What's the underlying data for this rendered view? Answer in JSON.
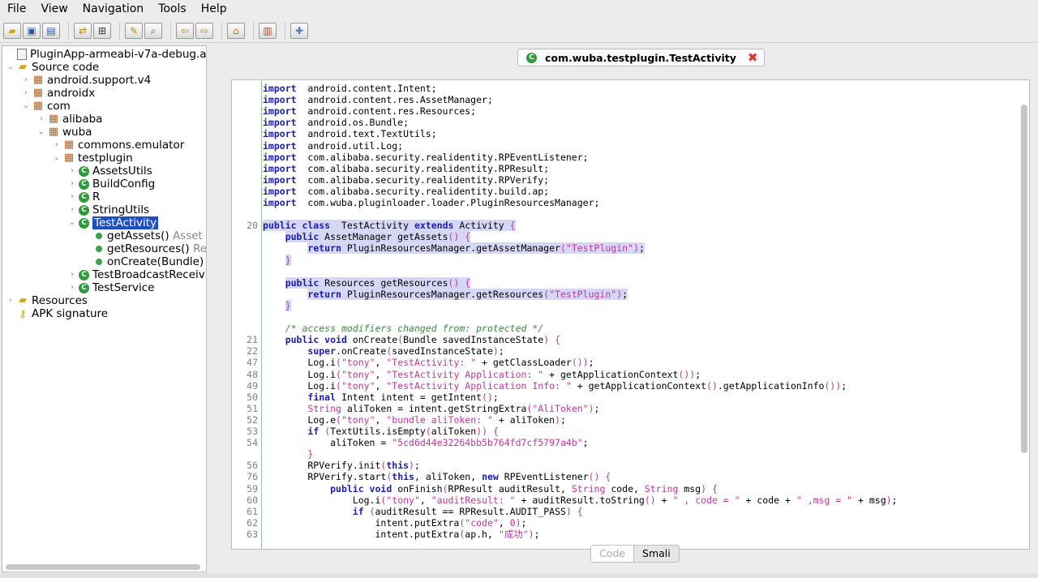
{
  "menu": [
    "File",
    "View",
    "Navigation",
    "Tools",
    "Help"
  ],
  "toolbar": {
    "groups": [
      [
        "folder-open-icon",
        "save-icon",
        "save-all-icon"
      ],
      [
        "sync-icon",
        "grid-icon"
      ],
      [
        "wand-icon",
        "search-icon"
      ],
      [
        "back-arrow-icon",
        "forward-arrow-icon"
      ],
      [
        "bag-icon"
      ],
      [
        "log-icon"
      ],
      [
        "wrench-icon"
      ]
    ]
  },
  "tree": {
    "items": [
      {
        "label": "PluginApp-armeabi-v7a-debug.apk",
        "icon": "apk-icon",
        "depth": 0,
        "chev": ""
      },
      {
        "label": "Source code",
        "icon": "folder-icon",
        "depth": 0,
        "chev": "open"
      },
      {
        "label": "android.support.v4",
        "icon": "package-icon",
        "depth": 1,
        "chev": "closed"
      },
      {
        "label": "androidx",
        "icon": "package-icon",
        "depth": 1,
        "chev": "closed"
      },
      {
        "label": "com",
        "icon": "package-icon",
        "depth": 1,
        "chev": "open"
      },
      {
        "label": "alibaba",
        "icon": "package-icon",
        "depth": 2,
        "chev": "closed"
      },
      {
        "label": "wuba",
        "icon": "package-icon",
        "depth": 2,
        "chev": "open"
      },
      {
        "label": "commons.emulator",
        "icon": "package-icon",
        "depth": 3,
        "chev": "closed"
      },
      {
        "label": "testplugin",
        "icon": "package-icon",
        "depth": 3,
        "chev": "open"
      },
      {
        "label": "AssetsUtils",
        "icon": "class-icon",
        "depth": 4,
        "chev": "closed"
      },
      {
        "label": "BuildConfig",
        "icon": "class-icon",
        "depth": 4,
        "chev": "closed"
      },
      {
        "label": "R",
        "icon": "class-icon",
        "depth": 4,
        "chev": "closed"
      },
      {
        "label": "StringUtils",
        "icon": "class-icon",
        "depth": 4,
        "chev": "closed"
      },
      {
        "label": "TestActivity",
        "icon": "class-icon",
        "depth": 4,
        "chev": "open",
        "selected": true
      },
      {
        "label": "getAssets()",
        "ret": "Asset",
        "icon": "method-icon",
        "depth": 5,
        "chev": ""
      },
      {
        "label": "getResources()",
        "ret": "Re",
        "icon": "method-icon",
        "depth": 5,
        "chev": ""
      },
      {
        "label": "onCreate(Bundle)",
        "icon": "method-icon",
        "depth": 5,
        "chev": ""
      },
      {
        "label": "TestBroadcastReceiv",
        "icon": "class-icon",
        "depth": 4,
        "chev": "closed"
      },
      {
        "label": "TestService",
        "icon": "class-icon",
        "depth": 4,
        "chev": "closed"
      },
      {
        "label": "Resources",
        "icon": "folder-icon",
        "depth": 0,
        "chev": "closed"
      },
      {
        "label": "APK signature",
        "icon": "key-icon",
        "depth": 0,
        "chev": ""
      }
    ]
  },
  "editor": {
    "tab_title": "com.wuba.testplugin.TestActivity",
    "bottom_tabs": [
      "Code",
      "Smali"
    ],
    "lines": [
      {
        "n": "",
        "t": [
          [
            "kw",
            "import"
          ],
          [
            "",
            "  android.content.Intent;"
          ]
        ]
      },
      {
        "n": "",
        "t": [
          [
            "kw",
            "import"
          ],
          [
            "",
            "  android.content.res.AssetManager;"
          ]
        ]
      },
      {
        "n": "",
        "t": [
          [
            "kw",
            "import"
          ],
          [
            "",
            "  android.content.res.Resources;"
          ]
        ]
      },
      {
        "n": "",
        "t": [
          [
            "kw",
            "import"
          ],
          [
            "",
            "  android.os.Bundle;"
          ]
        ]
      },
      {
        "n": "",
        "t": [
          [
            "kw",
            "import"
          ],
          [
            "",
            "  android.text.TextUtils;"
          ]
        ]
      },
      {
        "n": "",
        "t": [
          [
            "kw",
            "import"
          ],
          [
            "",
            "  android.util.Log;"
          ]
        ]
      },
      {
        "n": "",
        "t": [
          [
            "kw",
            "import"
          ],
          [
            "",
            "  com.alibaba.security.realidentity.RPEventListener;"
          ]
        ]
      },
      {
        "n": "",
        "t": [
          [
            "kw",
            "import"
          ],
          [
            "",
            "  com.alibaba.security.realidentity.RPResult;"
          ]
        ]
      },
      {
        "n": "",
        "t": [
          [
            "kw",
            "import"
          ],
          [
            "",
            "  com.alibaba.security.realidentity.RPVerify;"
          ]
        ]
      },
      {
        "n": "",
        "t": [
          [
            "kw",
            "import"
          ],
          [
            "",
            "  com.alibaba.security.realidentity.build.ap;"
          ]
        ]
      },
      {
        "n": "",
        "t": [
          [
            "kw",
            "import"
          ],
          [
            "",
            "  com.wuba.pluginloader.loader.PluginResourcesManager;"
          ]
        ]
      },
      {
        "n": "",
        "t": []
      },
      {
        "n": "20",
        "hl": true,
        "t": [
          [
            "kw",
            "public class"
          ],
          [
            "",
            "  TestActivity "
          ],
          [
            "kw",
            "extends"
          ],
          [
            "",
            " Activity "
          ],
          [
            "br",
            "{"
          ]
        ]
      },
      {
        "n": "",
        "hl": true,
        "t": [
          [
            "",
            "    "
          ],
          [
            "kw",
            "public"
          ],
          [
            "",
            " AssetManager getAssets"
          ],
          [
            "br",
            "()"
          ],
          [
            "",
            " "
          ],
          [
            "br",
            "{"
          ]
        ]
      },
      {
        "n": "",
        "hl": true,
        "t": [
          [
            "",
            "        "
          ],
          [
            "kw",
            "return"
          ],
          [
            "",
            " PluginResourcesManager.getAssetManager"
          ],
          [
            "br",
            "("
          ],
          [
            "str",
            "\"TestPlugin\""
          ],
          [
            "br",
            ")"
          ],
          [
            "",
            ";"
          ]
        ]
      },
      {
        "n": "",
        "hl": true,
        "t": [
          [
            "",
            "    "
          ],
          [
            "br",
            "}"
          ]
        ]
      },
      {
        "n": "",
        "t": []
      },
      {
        "n": "",
        "hl": true,
        "t": [
          [
            "",
            "    "
          ],
          [
            "kw",
            "public"
          ],
          [
            "",
            " Resources getResources"
          ],
          [
            "br",
            "()"
          ],
          [
            "",
            " "
          ],
          [
            "br",
            "{"
          ]
        ]
      },
      {
        "n": "",
        "hl": true,
        "t": [
          [
            "",
            "        "
          ],
          [
            "kw",
            "return"
          ],
          [
            "",
            " PluginResourcesManager.getResources"
          ],
          [
            "br",
            "("
          ],
          [
            "str",
            "\"TestPlugin\""
          ],
          [
            "br",
            ")"
          ],
          [
            "",
            ";"
          ]
        ]
      },
      {
        "n": "",
        "hl": true,
        "t": [
          [
            "",
            "    "
          ],
          [
            "br",
            "}"
          ]
        ]
      },
      {
        "n": "",
        "t": []
      },
      {
        "n": "",
        "t": [
          [
            "",
            "    "
          ],
          [
            "cm",
            "/* access modifiers changed from: protected */"
          ]
        ]
      },
      {
        "n": "21",
        "t": [
          [
            "",
            "    "
          ],
          [
            "kw",
            "public void"
          ],
          [
            "",
            " onCreate"
          ],
          [
            "br",
            "("
          ],
          [
            "",
            "Bundle savedInstanceState"
          ],
          [
            "br",
            ")"
          ],
          [
            "",
            " "
          ],
          [
            "br",
            "{"
          ]
        ]
      },
      {
        "n": "22",
        "t": [
          [
            "",
            "        "
          ],
          [
            "kw",
            "super"
          ],
          [
            "",
            ".onCreate"
          ],
          [
            "br",
            "("
          ],
          [
            "",
            "savedInstanceState"
          ],
          [
            "br",
            ")"
          ],
          [
            "",
            ";"
          ]
        ]
      },
      {
        "n": "47",
        "t": [
          [
            "",
            "        Log.i"
          ],
          [
            "br",
            "("
          ],
          [
            "str",
            "\"tony\""
          ],
          [
            "",
            ", "
          ],
          [
            "str",
            "\"TestActivity: \""
          ],
          [
            "",
            " + getClassLoader"
          ],
          [
            "br",
            "())"
          ],
          [
            "",
            ";"
          ]
        ]
      },
      {
        "n": "48",
        "t": [
          [
            "",
            "        Log.i"
          ],
          [
            "br",
            "("
          ],
          [
            "str",
            "\"tony\""
          ],
          [
            "",
            ", "
          ],
          [
            "str",
            "\"TestActivity Application: \""
          ],
          [
            "",
            " + getApplicationContext"
          ],
          [
            "br",
            "())"
          ],
          [
            "",
            ";"
          ]
        ]
      },
      {
        "n": "49",
        "t": [
          [
            "",
            "        Log.i"
          ],
          [
            "br",
            "("
          ],
          [
            "str",
            "\"tony\""
          ],
          [
            "",
            ", "
          ],
          [
            "str",
            "\"TestActivity Application Info: \""
          ],
          [
            "",
            " + getApplicationContext"
          ],
          [
            "br",
            "()"
          ],
          [
            "",
            ".getApplicationInfo"
          ],
          [
            "br",
            "())"
          ],
          [
            "",
            ";"
          ]
        ]
      },
      {
        "n": "50",
        "t": [
          [
            "",
            "        "
          ],
          [
            "kw",
            "final"
          ],
          [
            "",
            " Intent intent = getIntent"
          ],
          [
            "br",
            "()"
          ],
          [
            "",
            ";"
          ]
        ]
      },
      {
        "n": "51",
        "t": [
          [
            "",
            "        "
          ],
          [
            "str",
            "String"
          ],
          [
            "",
            " aliToken = intent.getStringExtra"
          ],
          [
            "br",
            "("
          ],
          [
            "str",
            "\"AliToken\""
          ],
          [
            "br",
            ")"
          ],
          [
            "",
            ";"
          ]
        ]
      },
      {
        "n": "52",
        "t": [
          [
            "",
            "        Log.e"
          ],
          [
            "br",
            "("
          ],
          [
            "str",
            "\"tony\""
          ],
          [
            "",
            ", "
          ],
          [
            "str",
            "\"bundle aliToken: \""
          ],
          [
            "",
            " + aliToken"
          ],
          [
            "br",
            ")"
          ],
          [
            "",
            ";"
          ]
        ]
      },
      {
        "n": "53",
        "t": [
          [
            "",
            "        "
          ],
          [
            "kw",
            "if"
          ],
          [
            "",
            " "
          ],
          [
            "br",
            "("
          ],
          [
            "",
            "TextUtils.isEmpty"
          ],
          [
            "br",
            "("
          ],
          [
            "",
            "aliToken"
          ],
          [
            "br",
            "))"
          ],
          [
            "",
            " "
          ],
          [
            "br",
            "{"
          ]
        ]
      },
      {
        "n": "54",
        "t": [
          [
            "",
            "            aliToken = "
          ],
          [
            "str",
            "\"5cd6d44e32264bb5b764fd7cf5797a4b\""
          ],
          [
            "",
            ";"
          ]
        ]
      },
      {
        "n": "",
        "t": [
          [
            "",
            "        "
          ],
          [
            "br",
            "}"
          ]
        ]
      },
      {
        "n": "56",
        "t": [
          [
            "",
            "        RPVerify.init"
          ],
          [
            "br",
            "("
          ],
          [
            "kw",
            "this"
          ],
          [
            "br",
            ")"
          ],
          [
            "",
            ";"
          ]
        ]
      },
      {
        "n": "76",
        "t": [
          [
            "",
            "        RPVerify.start"
          ],
          [
            "br",
            "("
          ],
          [
            "kw",
            "this"
          ],
          [
            "",
            ", aliToken, "
          ],
          [
            "kw",
            "new"
          ],
          [
            "",
            " RPEventListener"
          ],
          [
            "br",
            "()"
          ],
          [
            "",
            " "
          ],
          [
            "br",
            "{"
          ]
        ]
      },
      {
        "n": "59",
        "t": [
          [
            "",
            "            "
          ],
          [
            "kw",
            "public void"
          ],
          [
            "",
            " onFinish"
          ],
          [
            "br",
            "("
          ],
          [
            "",
            "RPResult auditResult, "
          ],
          [
            "str",
            "String"
          ],
          [
            "",
            " code, "
          ],
          [
            "str",
            "String"
          ],
          [
            "",
            " msg"
          ],
          [
            "br",
            ")"
          ],
          [
            "",
            " "
          ],
          [
            "br",
            "{"
          ]
        ]
      },
      {
        "n": "60",
        "t": [
          [
            "",
            "                Log.i"
          ],
          [
            "br",
            "("
          ],
          [
            "str",
            "\"tony\""
          ],
          [
            "",
            ", "
          ],
          [
            "str",
            "\"auditResult: \""
          ],
          [
            "",
            " + auditResult.toString"
          ],
          [
            "br",
            "()"
          ],
          [
            "",
            " + "
          ],
          [
            "str",
            "\" , code = \""
          ],
          [
            "",
            " + code + "
          ],
          [
            "str",
            "\" ,msg = \""
          ],
          [
            "",
            " + msg"
          ],
          [
            "br",
            ")"
          ],
          [
            "",
            ";"
          ]
        ]
      },
      {
        "n": "61",
        "t": [
          [
            "",
            "                "
          ],
          [
            "kw",
            "if"
          ],
          [
            "",
            " "
          ],
          [
            "br",
            "("
          ],
          [
            "",
            "auditResult == RPResult.AUDIT_PASS"
          ],
          [
            "br",
            ")"
          ],
          [
            "",
            " "
          ],
          [
            "br",
            "{"
          ]
        ]
      },
      {
        "n": "62",
        "t": [
          [
            "",
            "                    intent.putExtra"
          ],
          [
            "br",
            "("
          ],
          [
            "str",
            "\"code\""
          ],
          [
            "",
            ", "
          ],
          [
            "br",
            "0"
          ],
          [
            "br",
            ")"
          ],
          [
            "",
            ";"
          ]
        ]
      },
      {
        "n": "63",
        "t": [
          [
            "",
            "                    intent.putExtra"
          ],
          [
            "br",
            "("
          ],
          [
            "",
            "ap.h, "
          ],
          [
            "str",
            "\"成功\""
          ],
          [
            "br",
            ")"
          ],
          [
            "",
            ";"
          ]
        ]
      }
    ]
  }
}
